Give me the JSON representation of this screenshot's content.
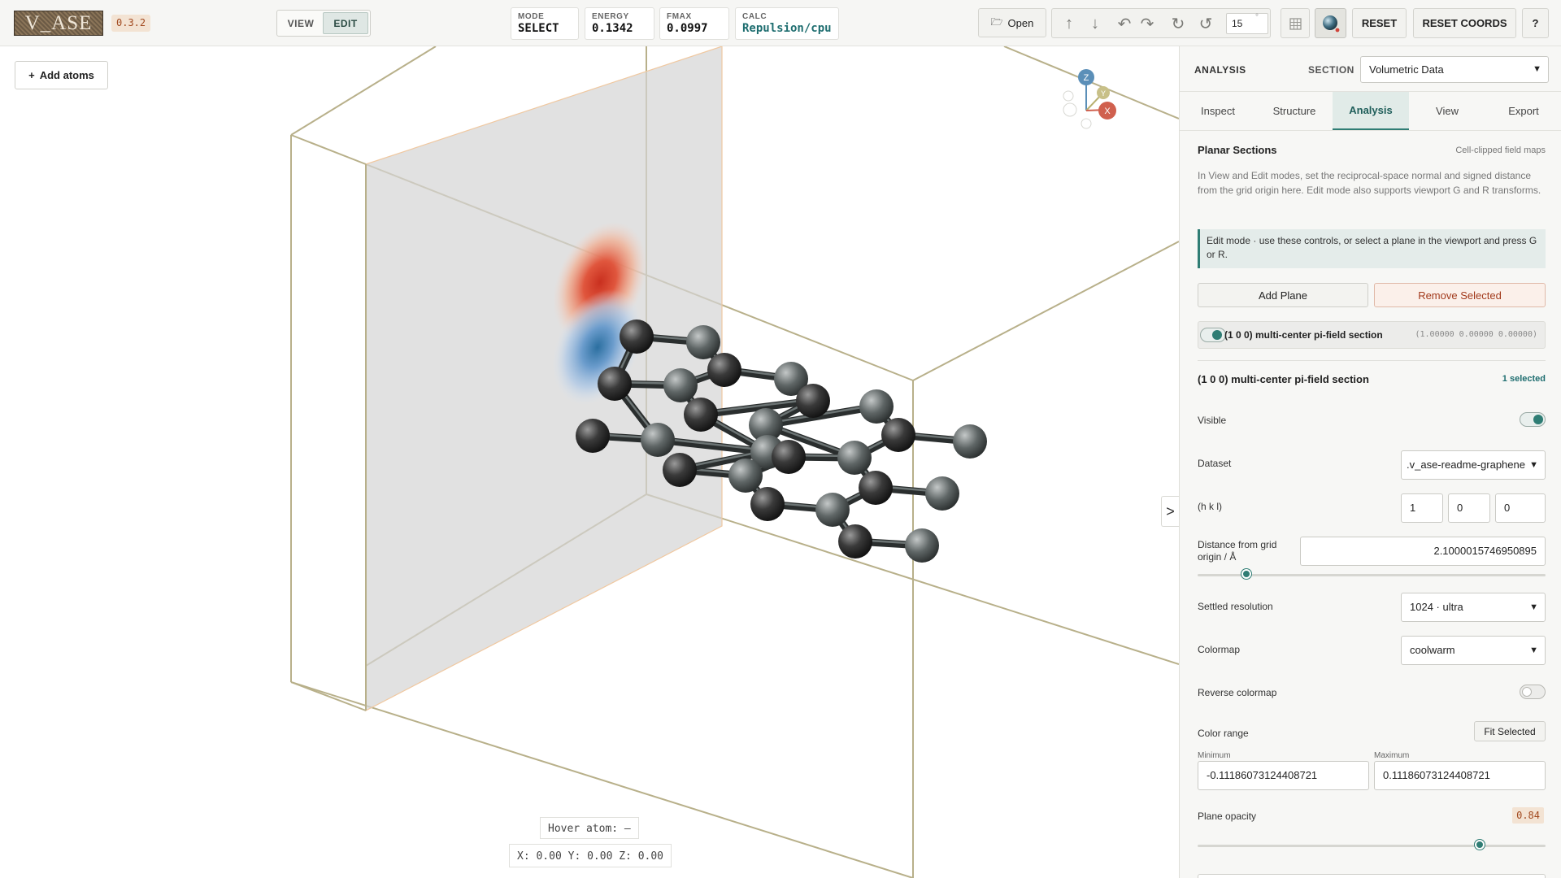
{
  "app": {
    "logo_text": "V_ASE",
    "version": "0.3.2"
  },
  "mode_switch": {
    "view_label": "VIEW",
    "edit_label": "EDIT",
    "active": "EDIT"
  },
  "stats": {
    "mode": {
      "label": "MODE",
      "value": "SELECT"
    },
    "energy": {
      "label": "ENERGY",
      "value": "0.1342"
    },
    "fmax": {
      "label": "FMAX",
      "value": "0.0997"
    },
    "calc": {
      "label": "CALC",
      "value": "Repulsion/cpu"
    }
  },
  "toolbar": {
    "open_label": "Open",
    "tools": [
      "rotate-up-icon",
      "rotate-down-icon",
      "undo-icon",
      "redo-icon",
      "rotate-cw-icon",
      "rotate-ccw-icon"
    ],
    "angle_value": "15",
    "angle_unit": "°",
    "reset_label": "RESET",
    "reset_coords_label": "RESET COORDS",
    "help_label": "?"
  },
  "viewport": {
    "add_atoms_label": "Add atoms",
    "hover_atom": "Hover atom: –",
    "coord_readout": "X: 0.00 Y: 0.00 Z: 0.00",
    "collapse_label": ">",
    "axes": {
      "z": "Z",
      "y": "Y",
      "x": "X"
    }
  },
  "panel": {
    "title": "ANALYSIS",
    "section_label": "SECTION",
    "section_value": "Volumetric Data",
    "tabs": [
      {
        "label": "Inspect",
        "active": false
      },
      {
        "label": "Structure",
        "active": false
      },
      {
        "label": "Analysis",
        "active": true
      },
      {
        "label": "View",
        "active": false
      },
      {
        "label": "Export",
        "active": false
      }
    ],
    "planar": {
      "title": "Planar Sections",
      "subtitle": "Cell-clipped field maps",
      "description": "In View and Edit modes, set the reciprocal-space normal and signed distance from the grid origin here. Edit mode also supports viewport G and R transforms.",
      "hint": "Edit mode · use these controls, or select a plane in the viewport and press G or R.",
      "add_plane_label": "Add Plane",
      "remove_selected_label": "Remove Selected",
      "plane_row": {
        "name": "(1 0 0) multi-center pi-field section",
        "vector": "(1.00000 0.00000 0.00000)",
        "enabled": true
      },
      "selected": {
        "name": "(1 0 0) multi-center pi-field section",
        "count_label": "1 selected",
        "visible_label": "Visible",
        "visible": true,
        "dataset_label": "Dataset",
        "dataset_value": ".v_ase-readme-graphene",
        "hkl_label": "(h k l)",
        "h": "1",
        "k": "0",
        "l": "0",
        "distance_label": "Distance from grid origin / Å",
        "distance_value": "2.1000015746950895",
        "distance_slider_fraction": 0.13,
        "resolution_label": "Settled resolution",
        "resolution_value": "1024 · ultra",
        "colormap_label": "Colormap",
        "colormap_value": "coolwarm",
        "reverse_label": "Reverse colormap",
        "reverse": false,
        "color_range_label": "Color range",
        "fit_selected_label": "Fit Selected",
        "minimum_label": "Minimum",
        "minimum_value": "-0.11186073124408721",
        "maximum_label": "Maximum",
        "maximum_value": "0.11186073124408721",
        "opacity_label": "Plane opacity",
        "opacity_value": "0.84",
        "opacity_fraction": 0.82
      }
    }
  },
  "colors": {
    "accent": "#2f7d74",
    "warn": "#a24a20",
    "cell_edge": "#b8b08a",
    "carbon": "#2a2a2a"
  }
}
